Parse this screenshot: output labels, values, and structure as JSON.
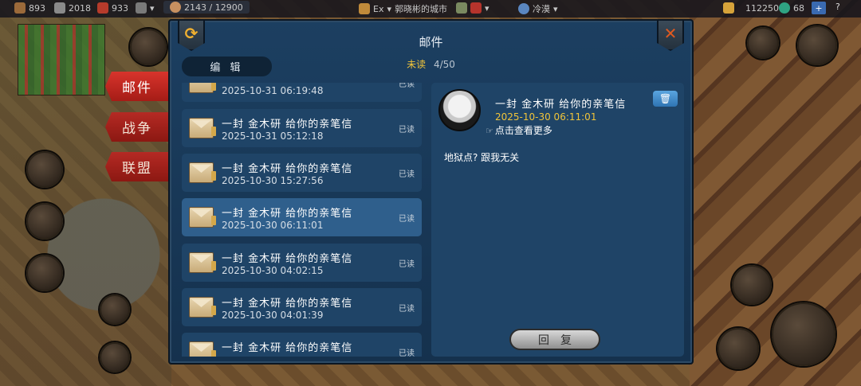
{
  "topbar": {
    "res1": "893",
    "res2": "2018",
    "res3": "933",
    "pop": "2143 / 12900",
    "server_tag": "Ex",
    "city": "郭晓彬的城市",
    "weather": "冷漠",
    "gold": "112250",
    "gems": "68",
    "plus": "+",
    "help": "?"
  },
  "tabs": [
    {
      "label": "邮件"
    },
    {
      "label": "战争"
    },
    {
      "label": "联盟"
    }
  ],
  "dialog": {
    "title": "邮件",
    "edit_label": "编 辑",
    "unread_label": "未读",
    "unread_count": "4/50"
  },
  "mails": [
    {
      "subject": "",
      "date": "2025-10-31  06:19:48",
      "status": "已读"
    },
    {
      "subject": "一封 金木研 给你的亲笔信",
      "date": "2025-10-31  05:12:18",
      "status": "已读"
    },
    {
      "subject": "一封 金木研 给你的亲笔信",
      "date": "2025-10-30  15:27:56",
      "status": "已读"
    },
    {
      "subject": "一封 金木研 给你的亲笔信",
      "date": "2025-10-30  06:11:01",
      "status": "已读"
    },
    {
      "subject": "一封 金木研 给你的亲笔信",
      "date": "2025-10-30  04:02:15",
      "status": "已读"
    },
    {
      "subject": "一封 金木研 给你的亲笔信",
      "date": "2025-10-30  04:01:39",
      "status": "已读"
    },
    {
      "subject": "一封 金木研 给你的亲笔信",
      "date": "",
      "status": "已读"
    }
  ],
  "detail": {
    "subject": "一封 金木研 给你的亲笔信",
    "date": "2025-10-30  06:11:01",
    "more": "点击查看更多",
    "body": "地狱点? 跟我无关",
    "reply_label": "回复"
  }
}
